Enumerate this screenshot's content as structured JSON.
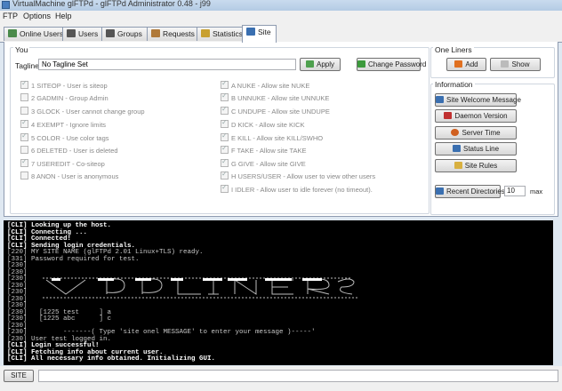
{
  "window": {
    "title": "VirtualMachine glFTPd - glFTPd Administrator 0.48 - j99"
  },
  "menu": [
    "FTP",
    "Options",
    "Help"
  ],
  "tabs": [
    {
      "label": "Online Users",
      "icon": "users-icon",
      "color": "#4a8a4a"
    },
    {
      "label": "Users",
      "icon": "user-icon",
      "color": "#555555"
    },
    {
      "label": "Groups",
      "icon": "groups-icon",
      "color": "#555555"
    },
    {
      "label": "Requests",
      "icon": "requests-icon",
      "color": "#b07a3a"
    },
    {
      "label": "Statistics",
      "icon": "statistics-icon",
      "color": "#c8a030"
    },
    {
      "label": "Site",
      "icon": "site-icon",
      "color": "#3a6fb0",
      "active": true
    }
  ],
  "you": {
    "label": "You",
    "tagline_label": "Tagline:",
    "tagline_value": "No Tagline Set",
    "apply": "Apply",
    "change_password": "Change Password"
  },
  "flags_left": [
    {
      "label": "1 SITEOP - User is siteop",
      "checked": true
    },
    {
      "label": "2 GADMIN - Group Admin",
      "checked": false
    },
    {
      "label": "3 GLOCK - User cannot change group",
      "checked": false
    },
    {
      "label": "4 EXEMPT - Ignore limits",
      "checked": true
    },
    {
      "label": "5 COLOR - Use color tags",
      "checked": true
    },
    {
      "label": "6 DELETED - User is deleted",
      "checked": false
    },
    {
      "label": "7 USEREDIT - Co-siteop",
      "checked": true
    },
    {
      "label": "8 ANON - User is anonymous",
      "checked": false
    }
  ],
  "flags_right": [
    {
      "label": "A NUKE - Allow site NUKE",
      "checked": true
    },
    {
      "label": "B UNNUKE - Allow site UNNUKE",
      "checked": true
    },
    {
      "label": "C UNDUPE - Allow site UNDUPE",
      "checked": true
    },
    {
      "label": "D KICK - Allow site KICK",
      "checked": true
    },
    {
      "label": "E KILL - Allow site KILL/SWHO",
      "checked": true
    },
    {
      "label": "F TAKE - Allow site TAKE",
      "checked": true
    },
    {
      "label": "G GIVE - Allow site GIVE",
      "checked": true
    },
    {
      "label": "H USERS/USER - Allow user to view other users",
      "checked": true
    },
    {
      "label": "I IDLER - Allow user to idle forever (no timeout).",
      "checked": true
    }
  ],
  "one_liners": {
    "label": "One Liners",
    "add": "Add",
    "show": "Show"
  },
  "information": {
    "label": "Information",
    "buttons": [
      "Site Welcome Message",
      "Daemon Version",
      "Server Time",
      "Status Line",
      "Site Rules"
    ],
    "recent_directories": "Recent Directories",
    "count": "10",
    "max": "max"
  },
  "console": [
    {
      "tag": "[CLI]",
      "text": "Looking up the host.",
      "bold": true
    },
    {
      "tag": "[CLI]",
      "text": "Connecting ...",
      "bold": true
    },
    {
      "tag": "[CLI]",
      "text": "Connected!",
      "bold": true
    },
    {
      "tag": "[CLI]",
      "text": "Sending login credentials.",
      "bold": true
    },
    {
      "tag": "[220]",
      "text": "MY SITE NAME (glFTPd 2.01 Linux+TLS) ready.",
      "bold": false
    },
    {
      "tag": "[331]",
      "text": "Password required for test.",
      "bold": false
    },
    {
      "tag": "[230]",
      "text": "",
      "bold": false
    },
    {
      "tag": "[230]",
      "text": "",
      "bold": false
    },
    {
      "tag": "[230]",
      "text": "",
      "bold": false
    },
    {
      "tag": "[230]",
      "text": "",
      "bold": false
    },
    {
      "tag": "[230]",
      "text": "",
      "bold": false
    },
    {
      "tag": "[230]",
      "text": "",
      "bold": false
    },
    {
      "tag": "[230]",
      "text": "",
      "bold": false
    },
    {
      "tag": "[230]",
      "text": "  [1225 test     ] a",
      "bold": false
    },
    {
      "tag": "[230]",
      "text": "  [1225 abc      ] c",
      "bold": false
    },
    {
      "tag": "[230]",
      "text": "",
      "bold": false
    },
    {
      "tag": "[230]",
      "text": "        -------( Type 'site onel MESSAGE' to enter your message )-----'",
      "bold": false
    },
    {
      "tag": "[230]",
      "text": "User test logged in.",
      "bold": false
    },
    {
      "tag": "[CLI]",
      "text": "Login successful!",
      "bold": true
    },
    {
      "tag": "[CLI]",
      "text": "Fetching info about current user.",
      "bold": true
    },
    {
      "tag": "[CLI]",
      "text": "All necessary info obtained. Initializing GUI.",
      "bold": true
    }
  ],
  "bottom": {
    "site_button": "SITE",
    "command_value": ""
  }
}
